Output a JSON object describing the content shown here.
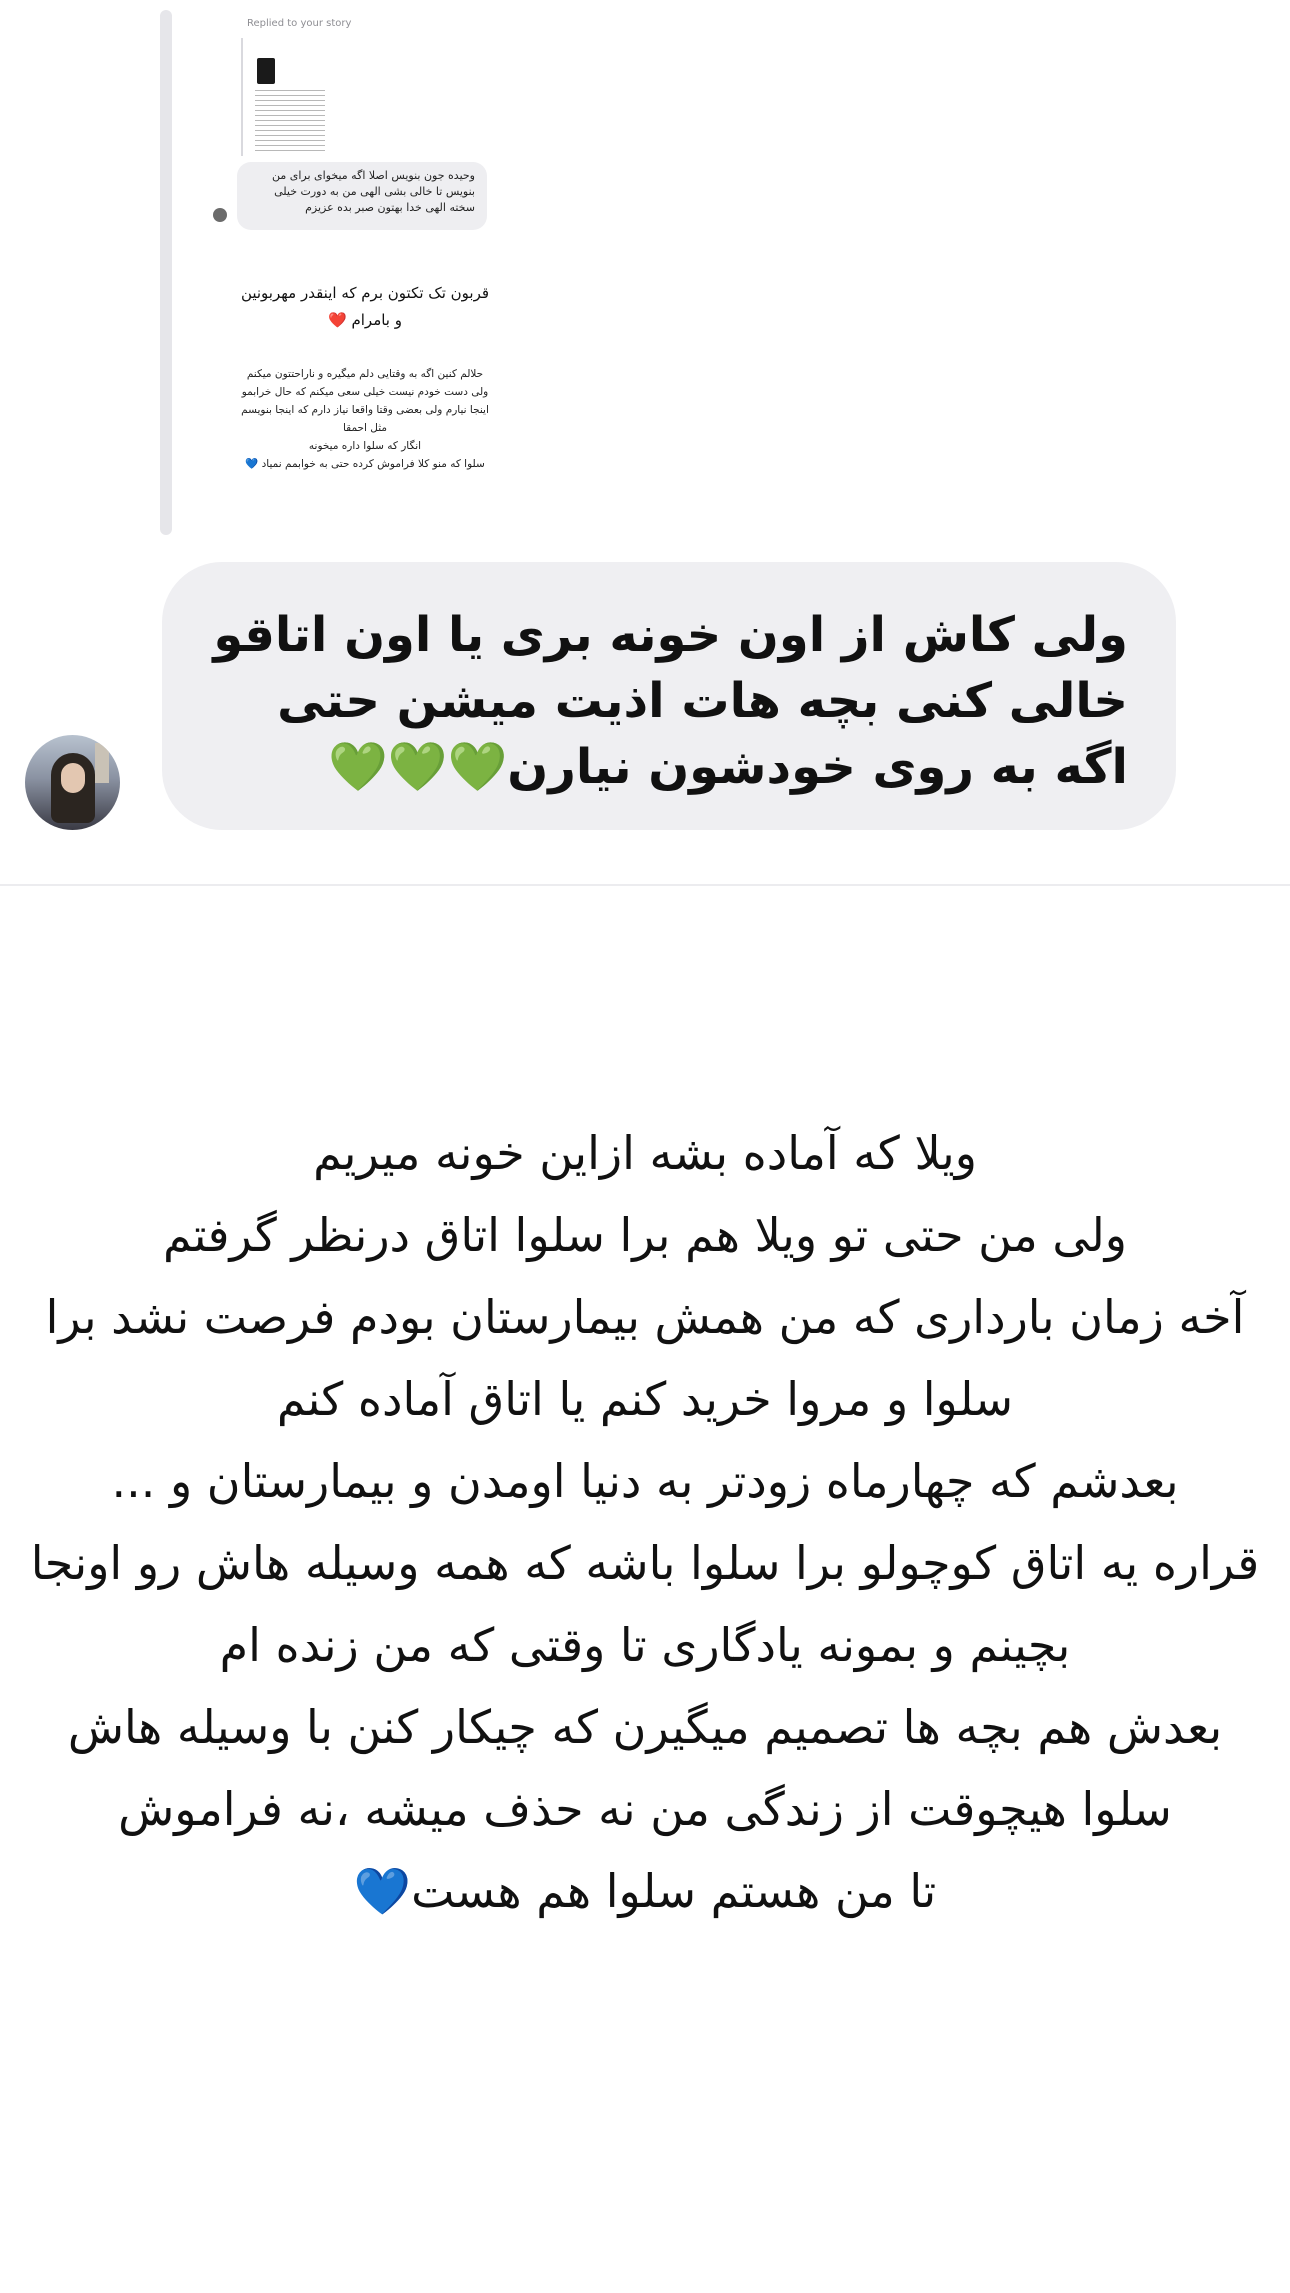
{
  "quoted_story": {
    "replied_label": "Replied to your story",
    "reply_bubble": "وحیده جون بنویس اصلا اگه میخوای برای من بنویس تا خالی بشی الهی من به دورت خیلی سخته الهی خدا بهتون صبر بده عزیزم",
    "heading": "قربون تک تکتون برم که اینقدر مهربونین و بامرام ❤️",
    "body": "حلالم کنین اگه به وقتایی دلم میگیره و ناراحتتون میکنم\nولی دست خودم نیست خیلی سعی میکنم که حال خرابمو\nاینجا نیارم ولی بعضی وقتا واقعا نیاز دارم که اینجا بنویسم\nمثل احمقا\nانگار که سلوا داره میخونه\nسلوا که منو کلا فراموش کرده حتی به خوابمم نمیاد 💙"
  },
  "message": {
    "text": "ولی کاش از اون خونه بری یا اون اتاقو خالی کنی بچه هات اذیت میشن حتی اگه به روی خودشون نیارن💚💚💚"
  },
  "story_text": {
    "lines": [
      "ویلا که آماده بشه ازاین خونه میریم",
      "ولی من حتی تو ویلا هم برا سلوا اتاق درنظر گرفتم",
      "آخه زمان بارداری که من همش بیمارستان بودم فرصت نشد برا",
      "سلوا و مروا خرید کنم یا اتاق آماده کنم",
      "بعدشم که چهارماه زودتر به دنیا اومدن و بیمارستان و ...",
      "قراره یه اتاق کوچولو برا سلوا باشه که همه وسیله هاش رو اونجا",
      "بچینم و بمونه یادگاری تا وقتی که من زنده ام",
      "بعدش هم بچه ها تصمیم میگیرن که چیکار کنن با وسیله هاش",
      "سلوا هیچوقت از زندگی من نه حذف میشه ،نه فراموش",
      "تا من هستم سلوا هم هست💙"
    ]
  }
}
